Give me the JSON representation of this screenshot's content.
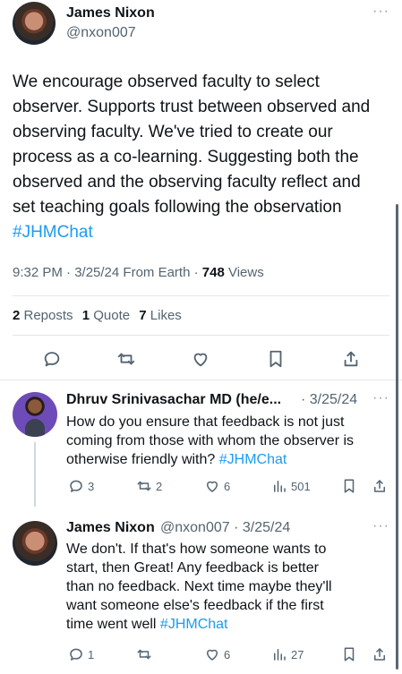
{
  "main_tweet": {
    "author_name": "James Nixon",
    "handle": "@nxon007",
    "text_lines": [
      "We encourage observed faculty to select",
      "observer. Supports trust between  observed and",
      "observing faculty. We've tried to create our",
      "process as a co-learning. Suggesting both the",
      "observed and the observing faculty reflect and",
      "set teaching goals following the observation"
    ],
    "hashtag": "#JHMChat",
    "meta_prefix": "9:32 PM · 3/25/24 From Earth · ",
    "views_count": "748",
    "views_label": " Views",
    "reposts_count": "2",
    "reposts_label": " Reposts",
    "quote_count": "1",
    "quote_label": " Quote",
    "likes_count": "7",
    "likes_label": " Likes"
  },
  "replies": [
    {
      "author_name": "Dhruv Srinivasachar MD (he/e...",
      "date": "· 3/25/24",
      "text_lines": [
        "How do you ensure that feedback is not just",
        "coming from those with whom the observer is"
      ],
      "last_line_prefix": "otherwise friendly with? ",
      "hashtag": "#JHMChat",
      "replies": "3",
      "reposts": "2",
      "likes": "6",
      "views": "501"
    },
    {
      "author_name": "James Nixon",
      "handle_date": "@nxon007 · 3/25/24",
      "text_lines": [
        "We don't. If that's how someone wants to",
        "start, then Great!  Any feedback is better",
        "than no feedback.  Next time maybe they'll",
        "want someone else's feedback if the first"
      ],
      "last_line_prefix": "time went well  ",
      "hashtag": "#JHMChat",
      "replies": "1",
      "reposts": "",
      "likes": "6",
      "views": "27"
    }
  ],
  "ui": {
    "more_glyph": "···",
    "accent_color": "#1d9bf0",
    "text_color": "#0f1419",
    "muted_color": "#536471"
  }
}
